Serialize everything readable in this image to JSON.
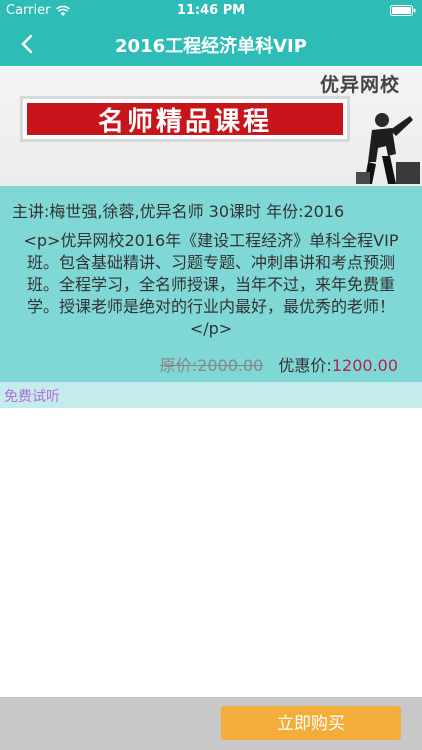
{
  "status_bar": {
    "carrier": "Carrier",
    "time": "11:46 PM",
    "wifi_icon": "wifi-icon",
    "battery_icon": "battery-icon"
  },
  "nav": {
    "title": "2016工程经济单科VIP",
    "back_icon": "chevron-left-icon"
  },
  "banner": {
    "school": "优异网校",
    "slogan": "名师精品课程"
  },
  "course": {
    "teacher_line": "主讲:梅世强,徐蓉,优异名师  30课时  年份:2016",
    "description": "<p>优异网校2016年《建设工程经济》单科全程VIP班。包含基础精讲、习题专题、冲刺串讲和考点预测班。全程学习，全名师授课，当年不过，来年免费重学。授课老师是绝对的行业内最好，最优秀的老师！</p>",
    "original_price": "原价:2000.00",
    "discount_label": "优惠价:",
    "discount_value": "1200.00"
  },
  "trial": {
    "label": "免费试听"
  },
  "footer": {
    "buy_label": "立即购买"
  },
  "colors": {
    "header": "#2dbcb6",
    "info_bg": "#7fd8d6",
    "trial_bg": "#c5ecec",
    "buy_button": "#f3ad3a",
    "discount_price": "#b0245a",
    "trial_text": "#b06fd8"
  }
}
